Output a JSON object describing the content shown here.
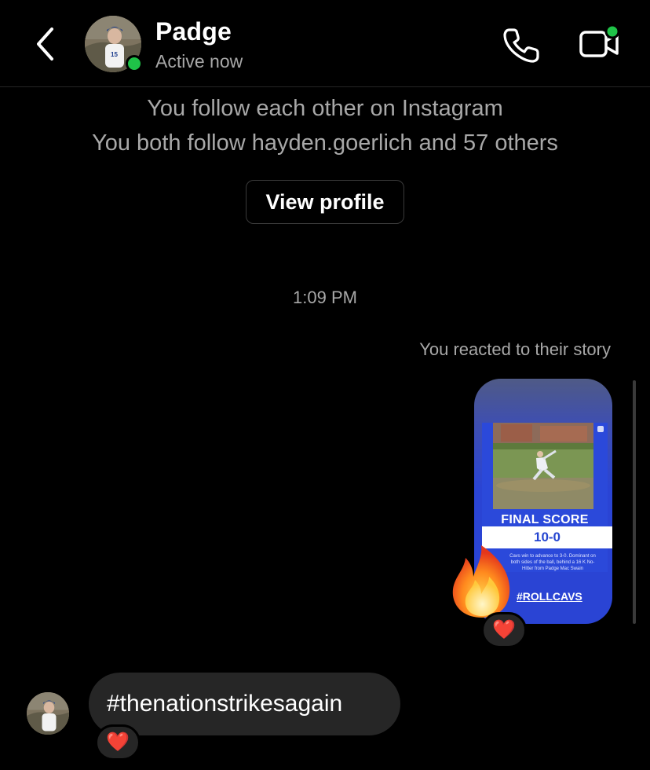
{
  "header": {
    "name": "Padge",
    "status": "Active now"
  },
  "profile_info": {
    "follow_line_1": "You follow each other on Instagram",
    "follow_line_2": "You both follow hayden.goerlich and 57 others",
    "view_profile_label": "View profile"
  },
  "thread": {
    "timestamp": "1:09 PM",
    "reacted_label": "You reacted to their story",
    "story": {
      "final_score_label": "FINAL SCORE",
      "score": "10-0",
      "description": "Cavs win to advance to 3-0. Dominant on both sides of the ball, behind a 16 K No-Hitter from Padge Mac Swain",
      "hashtag": "#ROLLCAVS"
    },
    "story_reaction_emoji": "🔥",
    "story_heart": "❤️",
    "message_text": "#thenationstrikesagain",
    "message_heart": "❤️"
  },
  "colors": {
    "background": "#000000",
    "online": "#1fc348",
    "bubble": "#262626",
    "story_blue": "#2a44d4",
    "secondary_text": "#a8a8a8"
  },
  "icons": [
    "back-icon",
    "phone-icon",
    "video-call-icon",
    "fire-icon",
    "heart-icon"
  ]
}
